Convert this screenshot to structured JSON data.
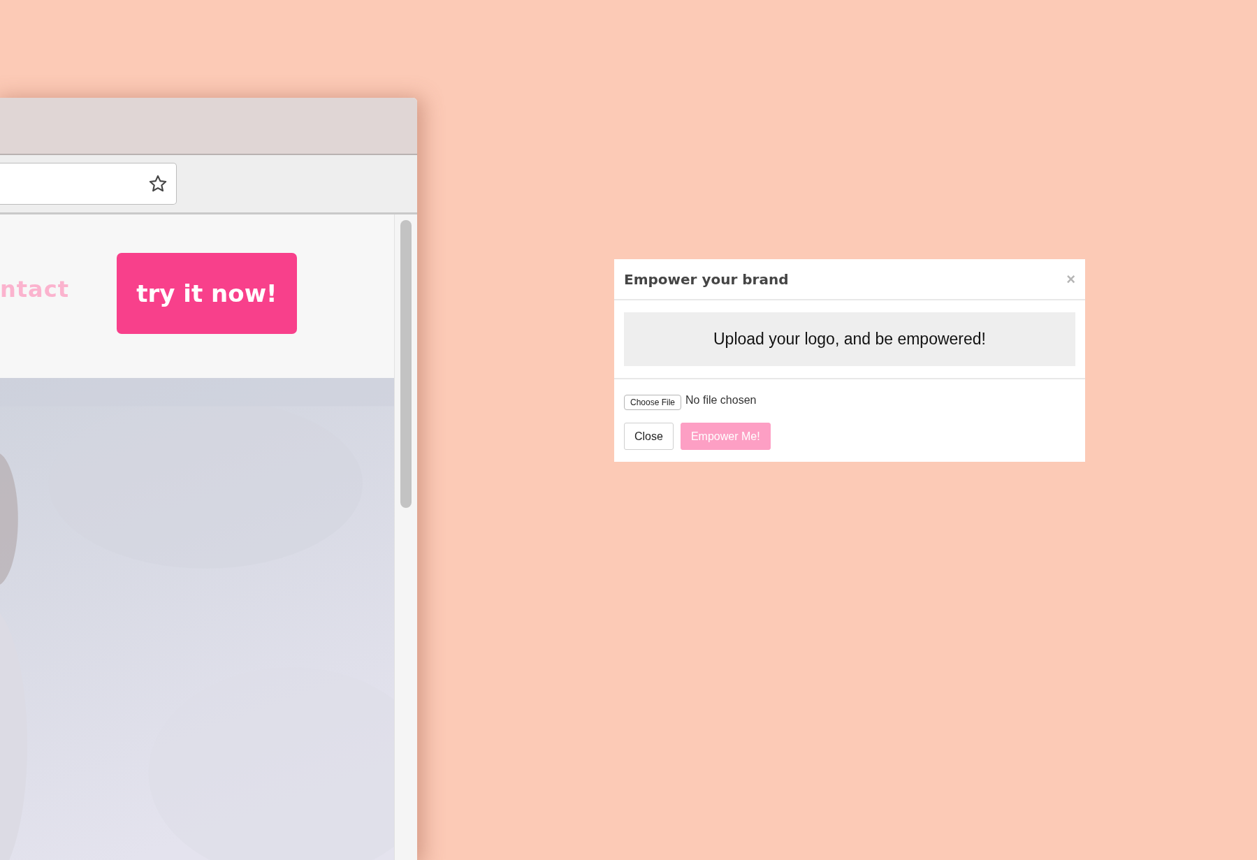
{
  "browser": {
    "nav_link": "ntact",
    "cta_button": "try it now!"
  },
  "modal": {
    "title": "Empower your brand",
    "close_icon": "×",
    "upload_prompt": "Upload your logo, and be empowered!",
    "file_button": "Choose File",
    "file_status": "No file chosen",
    "buttons": [
      {
        "label": "Close",
        "kind": "secondary",
        "disabled": false
      },
      {
        "label": "Empower Me!",
        "kind": "primary",
        "disabled": true
      }
    ]
  }
}
